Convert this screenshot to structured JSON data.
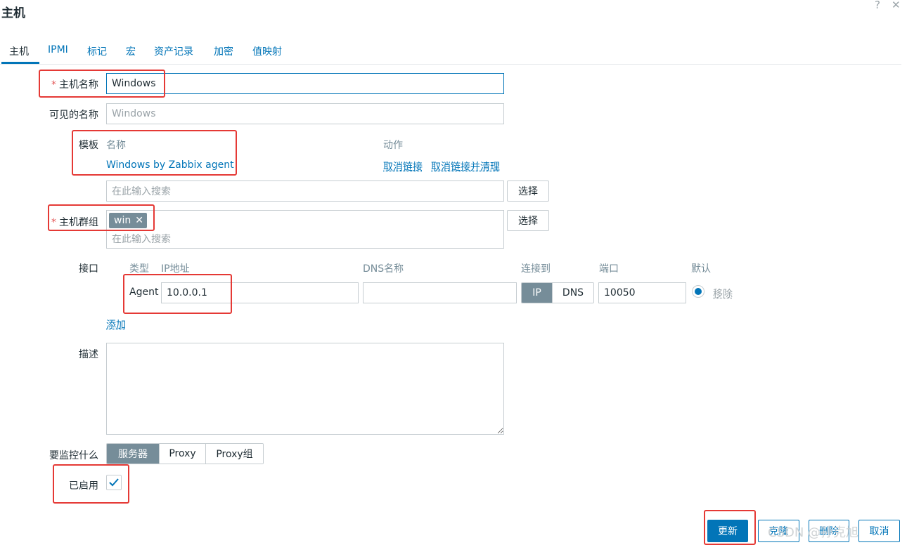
{
  "dialog": {
    "title": "主机",
    "help_label": "?",
    "close_label": "✕"
  },
  "tabs": [
    {
      "label": "主机",
      "active": true
    },
    {
      "label": "IPMI"
    },
    {
      "label": "标记"
    },
    {
      "label": "宏"
    },
    {
      "label": "资产记录"
    },
    {
      "label": "加密"
    },
    {
      "label": "值映射"
    }
  ],
  "form": {
    "host_name": {
      "label": "主机名称",
      "value": "Windows",
      "required": true
    },
    "visible_name": {
      "label": "可见的名称",
      "placeholder": "Windows"
    },
    "templates": {
      "label": "模板",
      "col_name": "名称",
      "col_action": "动作",
      "items": [
        {
          "name": "Windows by Zabbix agent",
          "unlink": "取消链接",
          "unlink_clear": "取消链接并清理"
        }
      ],
      "search_placeholder": "在此输入搜索",
      "select_label": "选择"
    },
    "host_groups": {
      "label": "主机群组",
      "required": true,
      "chips": [
        "win"
      ],
      "search_placeholder": "在此输入搜索",
      "select_label": "选择"
    },
    "interfaces": {
      "label": "接口",
      "col_type": "类型",
      "col_ip": "IP地址",
      "col_dns": "DNS名称",
      "col_connect": "连接到",
      "col_port": "端口",
      "col_default": "默认",
      "rows": [
        {
          "type": "Agent",
          "ip": "10.0.0.1",
          "dns": "",
          "connect_ip": "IP",
          "connect_dns": "DNS",
          "connect_selected": "IP",
          "port": "10050",
          "default": true,
          "remove": "移除"
        }
      ],
      "add_label": "添加"
    },
    "description": {
      "label": "描述",
      "value": ""
    },
    "monitored_by": {
      "label": "要监控什么",
      "options": [
        "服务器",
        "Proxy",
        "Proxy组"
      ],
      "selected": "服务器"
    },
    "enabled": {
      "label": "已启用",
      "checked": true
    }
  },
  "footer": {
    "update": "更新",
    "clone": "克隆",
    "delete": "删除",
    "cancel": "取消"
  },
  "watermark": "CSDN @孙克旭"
}
